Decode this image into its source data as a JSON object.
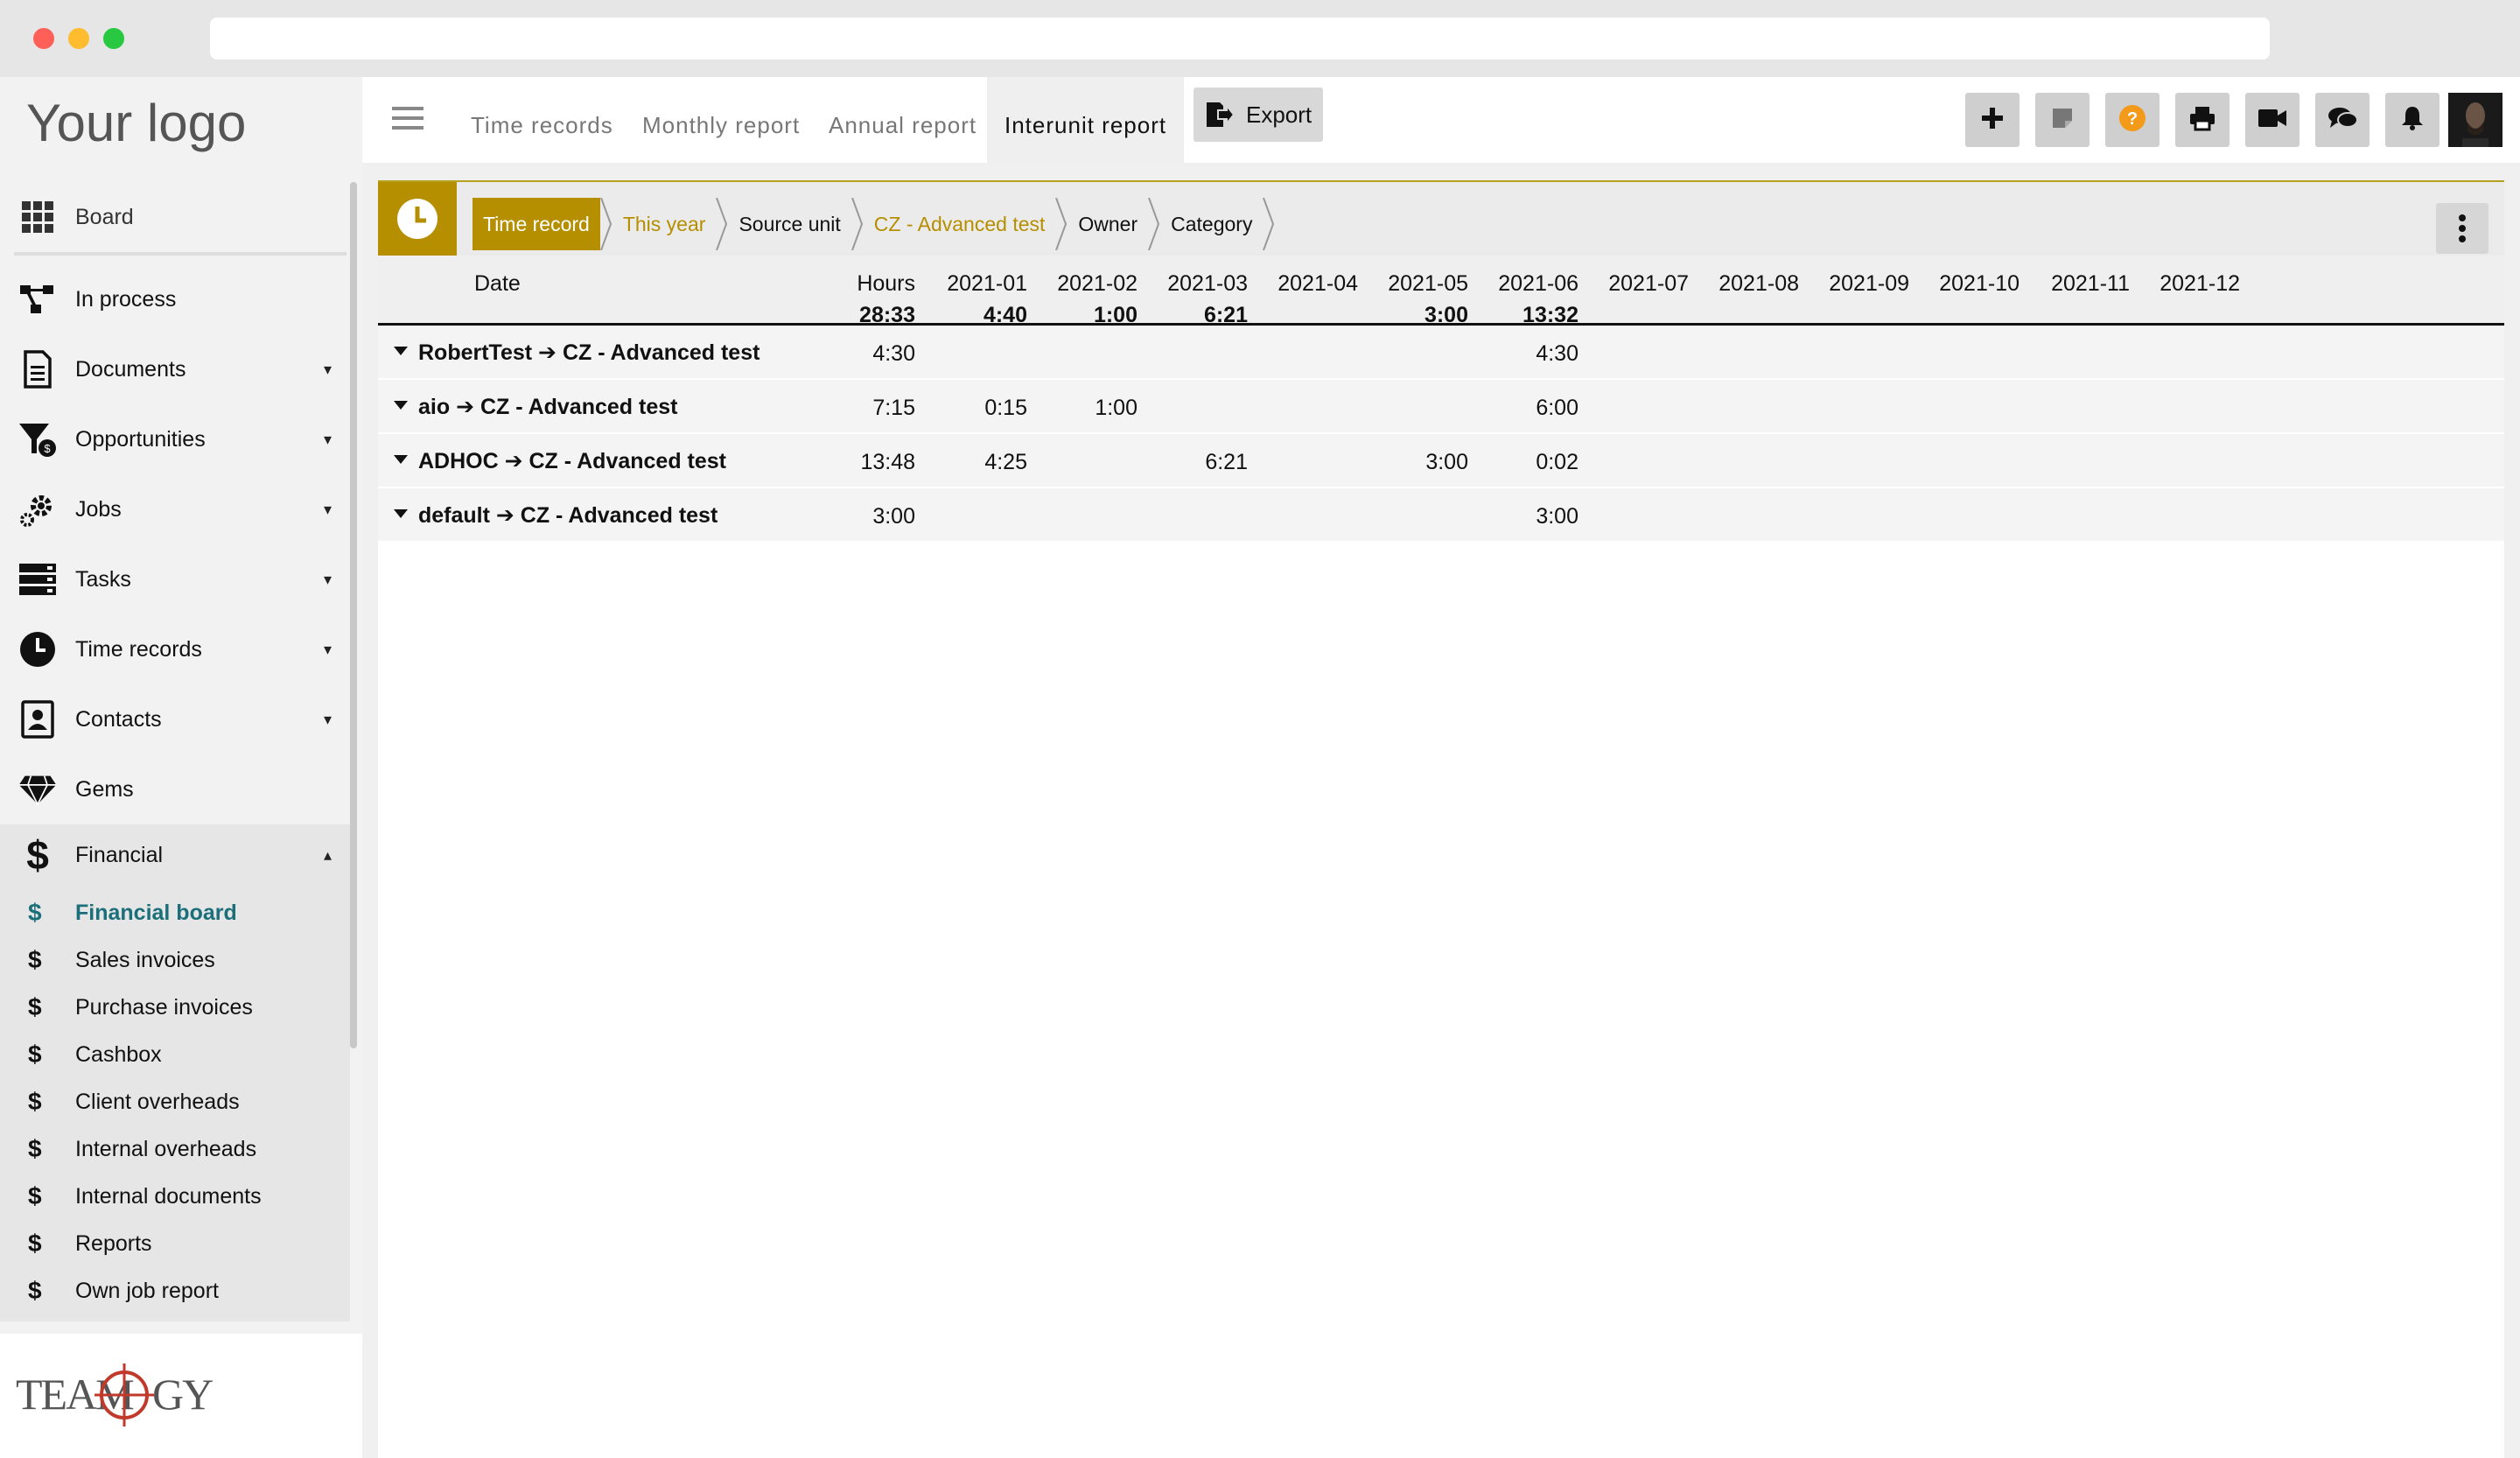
{
  "sidebar": {
    "logo": "Your logo",
    "items": [
      {
        "label": "Board",
        "icon": "grid-icon",
        "caret": ""
      },
      {
        "label": "In process",
        "icon": "flow-icon",
        "caret": ""
      },
      {
        "label": "Documents",
        "icon": "document-icon",
        "caret": "▾"
      },
      {
        "label": "Opportunities",
        "icon": "funnel-icon",
        "caret": "▾"
      },
      {
        "label": "Jobs",
        "icon": "gear-icon",
        "caret": "▾"
      },
      {
        "label": "Tasks",
        "icon": "tasks-icon",
        "caret": "▾"
      },
      {
        "label": "Time records",
        "icon": "clock-icon",
        "caret": "▾"
      },
      {
        "label": "Contacts",
        "icon": "contacts-icon",
        "caret": "▾"
      },
      {
        "label": "Gems",
        "icon": "gem-icon",
        "caret": ""
      },
      {
        "label": "Financial",
        "icon": "dollar-icon",
        "caret": "▴"
      }
    ],
    "financial_sub": [
      {
        "label": "Financial board",
        "active": true
      },
      {
        "label": "Sales invoices",
        "active": false
      },
      {
        "label": "Purchase invoices",
        "active": false
      },
      {
        "label": "Cashbox",
        "active": false
      },
      {
        "label": "Client overheads",
        "active": false
      },
      {
        "label": "Internal overheads",
        "active": false
      },
      {
        "label": "Internal documents",
        "active": false
      },
      {
        "label": "Reports",
        "active": false
      },
      {
        "label": "Own job report",
        "active": false
      }
    ],
    "dollar": "$",
    "brand": "TEAMOGY"
  },
  "topbar": {
    "tabs": [
      "Time records",
      "Monthly report",
      "Annual report",
      "Interunit report"
    ],
    "active_tab": "Interunit report",
    "export_label": "Export",
    "buttons": [
      "plus-icon",
      "note-icon",
      "help-icon",
      "print-icon",
      "video-icon",
      "chat-icon",
      "bell-icon"
    ]
  },
  "breadcrumbs": [
    "Time record",
    "This year",
    "Source unit",
    "CZ - Advanced test",
    "Owner",
    "Category"
  ],
  "table": {
    "header": {
      "date_label": "Date",
      "hours_label": "Hours",
      "hours_total": "28:33",
      "months": [
        "2021-01",
        "2021-02",
        "2021-03",
        "2021-04",
        "2021-05",
        "2021-06",
        "2021-07",
        "2021-08",
        "2021-09",
        "2021-10",
        "2021-11",
        "2021-12"
      ],
      "month_totals": [
        "4:40",
        "1:00",
        "6:21",
        "",
        "3:00",
        "13:32",
        "",
        "",
        "",
        "",
        "",
        ""
      ]
    },
    "rows": [
      {
        "name": "RobertTest ➔ CZ - Advanced test",
        "hours": "4:30",
        "months": [
          "",
          "",
          "",
          "",
          "",
          "4:30",
          "",
          "",
          "",
          "",
          "",
          ""
        ]
      },
      {
        "name": "aio ➔ CZ - Advanced test",
        "hours": "7:15",
        "months": [
          "0:15",
          "1:00",
          "",
          "",
          "",
          "6:00",
          "",
          "",
          "",
          "",
          "",
          ""
        ]
      },
      {
        "name": "ADHOC ➔ CZ - Advanced test",
        "hours": "13:48",
        "months": [
          "4:25",
          "",
          "6:21",
          "",
          "3:00",
          "0:02",
          "",
          "",
          "",
          "",
          "",
          ""
        ]
      },
      {
        "name": "default ➔ CZ - Advanced test",
        "hours": "3:00",
        "months": [
          "",
          "",
          "",
          "",
          "",
          "3:00",
          "",
          "",
          "",
          "",
          "",
          ""
        ]
      }
    ]
  }
}
